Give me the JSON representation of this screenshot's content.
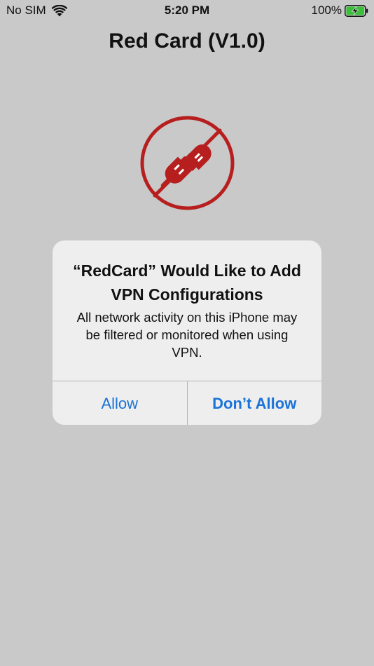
{
  "status_bar": {
    "carrier": "No SIM",
    "time": "5:20 PM",
    "battery": "100%",
    "battery_level": 1.0
  },
  "app": {
    "title": "Red Card (V1.0)",
    "icon": "unplugged-icon",
    "accent_color": "#b71f1f"
  },
  "alert": {
    "title_line1": "“RedCard” Would Like to Add",
    "title_line2": "VPN Configurations",
    "message_line1": "All network activity on this iPhone may",
    "message_line2": "be filtered or monitored when using",
    "message_line3": "VPN.",
    "allow_label": "Allow",
    "dont_allow_label": "Don’t Allow",
    "button_color": "#1a73d9"
  }
}
